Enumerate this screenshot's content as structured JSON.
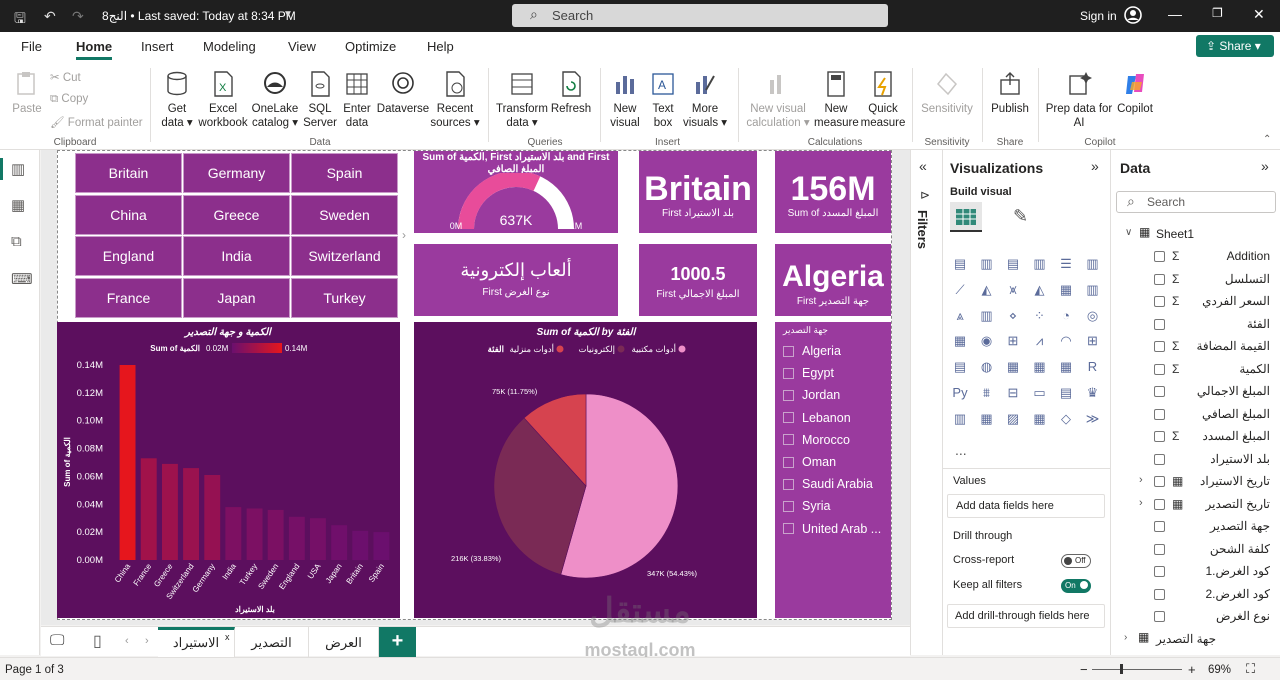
{
  "titlebar": {
    "title": "النج8 • Last saved: Today at 8:34 PM",
    "search_placeholder": "Search",
    "signin": "Sign in"
  },
  "menu": [
    "File",
    "Home",
    "Insert",
    "Modeling",
    "View",
    "Optimize",
    "Help"
  ],
  "share_label": "Share",
  "ribbon": {
    "clipboard": {
      "paste": "Paste",
      "cut": "Cut",
      "copy": "Copy",
      "format_painter": "Format painter",
      "group": "Clipboard"
    },
    "data": {
      "get_data": "Get data",
      "excel": "Excel workbook",
      "onelake": "OneLake catalog",
      "sql": "SQL Server",
      "enter": "Enter data",
      "dataverse": "Dataverse",
      "recent": "Recent sources",
      "group": "Data"
    },
    "queries": {
      "transform": "Transform data",
      "refresh": "Refresh",
      "group": "Queries"
    },
    "insert": {
      "new_visual": "New visual",
      "text_box": "Text box",
      "more_visuals": "More visuals",
      "group": "Insert"
    },
    "calculations": {
      "new_visual_calc": "New visual calculation",
      "new_measure": "New measure",
      "quick_measure": "Quick measure",
      "group": "Calculations"
    },
    "sensitivity": {
      "label": "Sensitivity",
      "group": "Sensitivity"
    },
    "share": {
      "publish": "Publish",
      "group": "Share"
    },
    "copilot": {
      "prep": "Prep data for AI",
      "copilot": "Copilot",
      "group": "Copilot"
    }
  },
  "slicer_tiles": [
    "Britain",
    "Germany",
    "Spain",
    "China",
    "Greece",
    "Sweden",
    "England",
    "India",
    "Switzerland",
    "France",
    "Japan",
    "Turkey"
  ],
  "gauge": {
    "title": "Sum of الكمية, First بلد الاستيراد and First المبلغ الصافي",
    "min": "0M",
    "max": "1M",
    "value": "637K",
    "fraction": 0.637
  },
  "card_country": {
    "value": "Britain",
    "label": "First بلد الاستيراد"
  },
  "card_total": {
    "value": "156M",
    "label": "Sum of المبلغ المسدد"
  },
  "card_type": {
    "value": "ألعاب إلكترونية",
    "label": "First نوع الغرض"
  },
  "card_amount": {
    "value": "1000.5",
    "label": "First المبلغ الاجمالي"
  },
  "card_dest": {
    "value": "Algeria",
    "label": "First جهة التصدير"
  },
  "bar_legend_label": "Sum of الكمية",
  "chart_data": [
    {
      "type": "bar",
      "title": "الكمية و جهة التصدير",
      "xlabel": "بلد الاستيراد",
      "ylabel": "Sum of الكمية",
      "legend": {
        "label": "Sum of الكمية",
        "min": "0.02M",
        "max": "0.14M"
      },
      "categories": [
        "China",
        "France",
        "Greece",
        "Switzerland",
        "Germany",
        "India",
        "Turkey",
        "Sweden",
        "England",
        "USA",
        "Japan",
        "Britain",
        "Spain"
      ],
      "values": [
        0.14,
        0.073,
        0.069,
        0.066,
        0.061,
        0.038,
        0.037,
        0.036,
        0.031,
        0.03,
        0.025,
        0.021,
        0.02
      ],
      "ylim": [
        0,
        0.14
      ],
      "yticks": [
        "0.00M",
        "0.02M",
        "0.04M",
        "0.06M",
        "0.08M",
        "0.10M",
        "0.12M",
        "0.14M"
      ]
    },
    {
      "type": "pie",
      "title": "Sum of الكمية by الفئة",
      "legend_title": "الفئة",
      "slices": [
        {
          "name": "أدوات مكتبية",
          "label": "347K (54.43%)",
          "value": 54.43,
          "color": "#ee8fc8"
        },
        {
          "name": "إلكترونيات",
          "label": "216K (33.83%)",
          "value": 33.83,
          "color": "#7a2a55"
        },
        {
          "name": "أدوات منزلية",
          "label": "75K (11.75%)",
          "value": 11.75,
          "color": "#d6434f"
        }
      ]
    }
  ],
  "dest_slicer": {
    "title": "جهة التصدير",
    "items": [
      "Algeria",
      "Egypt",
      "Jordan",
      "Lebanon",
      "Morocco",
      "Oman",
      "Saudi Arabia",
      "Syria",
      "United Arab ..."
    ]
  },
  "filters_label": "Filters",
  "viz_pane": {
    "title": "Visualizations",
    "build": "Build visual",
    "values": "Values",
    "add_data": "Add data fields here",
    "drill": "Drill through",
    "cross": "Cross-report",
    "cross_state": "Off",
    "keep": "Keep all filters",
    "keep_state": "On",
    "add_drill": "Add drill-through fields here",
    "more": "..."
  },
  "data_pane": {
    "title": "Data",
    "search": "Search",
    "table": "Sheet1",
    "fields": [
      {
        "name": "Addition",
        "sigma": true
      },
      {
        "name": "التسلسل",
        "sigma": true
      },
      {
        "name": "السعر الفردي",
        "sigma": true
      },
      {
        "name": "الفئة",
        "sigma": false
      },
      {
        "name": "القيمة المضافة",
        "sigma": true
      },
      {
        "name": "الكمية",
        "sigma": true
      },
      {
        "name": "المبلغ الاجمالي",
        "sigma": false
      },
      {
        "name": "المبلغ الصافي",
        "sigma": false
      },
      {
        "name": "المبلغ المسدد",
        "sigma": true
      },
      {
        "name": "بلد الاستيراد",
        "sigma": false
      },
      {
        "name": "تاريخ الاستيراد",
        "sigma": false
      },
      {
        "name": "تاريخ التصدير",
        "sigma": false
      },
      {
        "name": "جهة التصدير",
        "sigma": false
      },
      {
        "name": "كلفة الشحن",
        "sigma": false
      },
      {
        "name": "كود الغرض.1",
        "sigma": false
      },
      {
        "name": "كود الغرض.2",
        "sigma": false
      },
      {
        "name": "نوع الغرض",
        "sigma": false
      }
    ],
    "table2": "جهة التصدير"
  },
  "pages": [
    "الاستيراد",
    "التصدير",
    "العرض"
  ],
  "status": {
    "page": "Page 1 of 3",
    "zoom": "69%"
  },
  "watermark": {
    "top": "مستقل",
    "bottom": "mostaql.com"
  }
}
